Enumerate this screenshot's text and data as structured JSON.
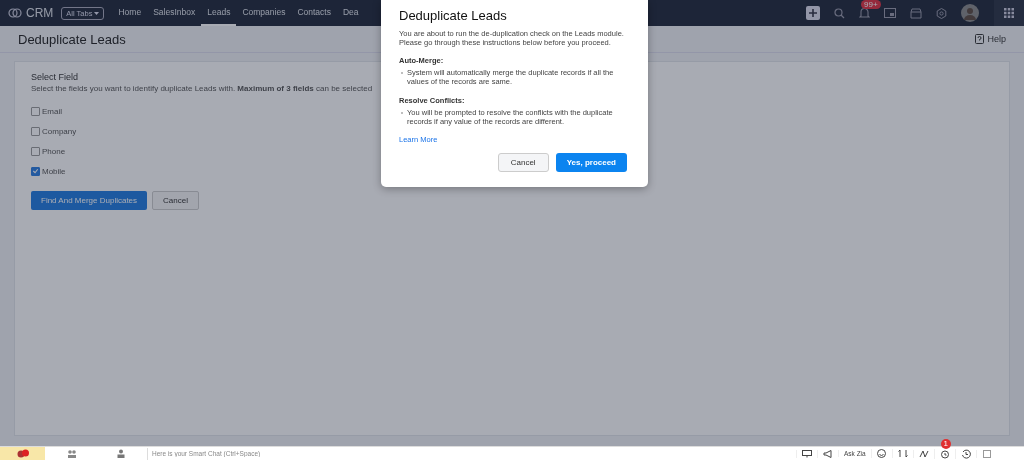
{
  "nav": {
    "logo": "CRM",
    "all_tabs": "All Tabs",
    "tabs": [
      {
        "label": "Home",
        "selected": false
      },
      {
        "label": "SalesInbox",
        "selected": false
      },
      {
        "label": "Leads",
        "selected": true
      },
      {
        "label": "Companies",
        "selected": false
      },
      {
        "label": "Contacts",
        "selected": false
      },
      {
        "label": "Dea",
        "selected": false
      }
    ],
    "notification_badge": "99+"
  },
  "header": {
    "title": "Deduplicate Leads",
    "help": "Help"
  },
  "form": {
    "heading": "Select Field",
    "description": "Select the fields you want to identify duplicate Leads with. **Maximum of 3 fields** can be selected",
    "fields": [
      {
        "label": "Email",
        "checked": false
      },
      {
        "label": "Company",
        "checked": false
      },
      {
        "label": "Phone",
        "checked": false
      },
      {
        "label": "Mobile",
        "checked": true
      }
    ],
    "buttons": {
      "primary": "Find And Merge Duplicates",
      "cancel": "Cancel"
    }
  },
  "dialog": {
    "title": "Deduplicate Leads",
    "intro": "You are about to run the de-duplication check on the Leads module. Please go through these instructions below before you proceed.",
    "sections": [
      {
        "heading": "Auto-Merge:",
        "text": "System will automatically merge the duplicate records if all the values of the records are same."
      },
      {
        "heading": "Resolve Conflicts:",
        "text": "You will be prompted to resolve the conflicts with the duplicate records if any value of the records are different."
      }
    ],
    "link": "Learn More",
    "cancel": "Cancel",
    "confirm": "Yes, proceed"
  },
  "bottom_bar": {
    "chat_placeholder": "Here is your Smart Chat (Ctrl+Space)",
    "ask_zia": "Ask Zia",
    "alarm_badge": "1"
  }
}
